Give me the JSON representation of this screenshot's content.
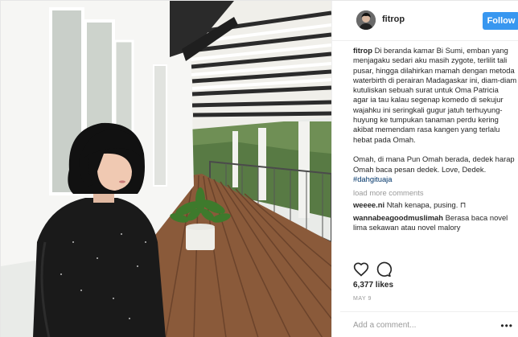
{
  "post": {
    "username": "fitrop",
    "follow_label": "Follow",
    "caption_user": "fitrop",
    "caption_text": "Di beranda kamar Bi Sumi, emban yang menjagaku sedari aku masih zygote, terlilit tali pusar, hingga dilahirkan mamah dengan metoda waterbirth di perairan Madagaskar ini, diam-diam kutuliskan sebuah surat untuk Oma Patricia\nagar ia tau kalau segenap komedo di sekujur wajahku ini seringkali gugur jatuh terhuyung-huyung ke tumpukan tanaman perdu kering akibat memendam rasa kangen yang terlalu hebat pada Omah.\n\nOmah, di mana Pun Omah berada, dedek harap Omah baca pesan dedek. Love, Dedek.",
    "hashtag": "#dahgituaja",
    "load_more": "load more comments",
    "comments": [
      {
        "user": "weeee.ni",
        "text": "Ntah kenapa, pusing. ⊓"
      },
      {
        "user": "wannabeagoodmuslimah",
        "text": "Berasa baca novel lima sekawan atau novel malory"
      }
    ],
    "likes": "6,377 likes",
    "date": "MAY 9",
    "add_comment_placeholder": "Add a comment...",
    "more_label": "•••"
  },
  "icons": {
    "like": "heart-icon",
    "comment": "comment-icon",
    "more": "more-options-icon"
  },
  "colors": {
    "follow_button": "#3897f0",
    "hashtag": "#003569",
    "muted": "#999999"
  }
}
